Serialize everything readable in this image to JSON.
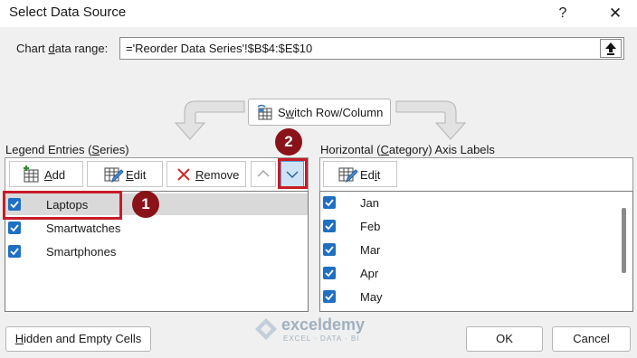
{
  "window": {
    "title": "Select Data Source",
    "help": "?",
    "close": "✕"
  },
  "range": {
    "label_pre": "Chart ",
    "label_key": "d",
    "label_post": "ata range:",
    "value": "='Reorder Data Series'!$B$4:$E$10"
  },
  "switch_button": {
    "pre": "S",
    "key": "w",
    "post": "itch Row/Column"
  },
  "legend": {
    "label_pre": "Legend Entries (",
    "label_key": "S",
    "label_post": "eries)",
    "add": {
      "key": "A",
      "rest": "dd"
    },
    "edit": {
      "key": "E",
      "rest": "dit"
    },
    "remove": {
      "key": "R",
      "rest": "emove"
    },
    "items": [
      {
        "label": "Laptops",
        "checked": true,
        "selected": true
      },
      {
        "label": "Smartwatches",
        "checked": true,
        "selected": false
      },
      {
        "label": "Smartphones",
        "checked": true,
        "selected": false
      }
    ]
  },
  "axis": {
    "label_pre": "Horizontal (",
    "label_key": "C",
    "label_post": "ategory) Axis Labels",
    "edit": {
      "pre": "Ed",
      "key": "i",
      "rest": "t"
    },
    "items": [
      {
        "label": "Jan",
        "checked": true
      },
      {
        "label": "Feb",
        "checked": true
      },
      {
        "label": "Mar",
        "checked": true
      },
      {
        "label": "Apr",
        "checked": true
      },
      {
        "label": "May",
        "checked": true
      }
    ]
  },
  "annotations": {
    "badge1": "1",
    "badge2": "2",
    "color": "#c71c27"
  },
  "buttons": {
    "hidden": {
      "key": "H",
      "rest": "idden and Empty Cells"
    },
    "ok": "OK",
    "cancel": "Cancel"
  },
  "watermark": {
    "name": "exceldemy",
    "tagline": "EXCEL · DATA · BI"
  }
}
